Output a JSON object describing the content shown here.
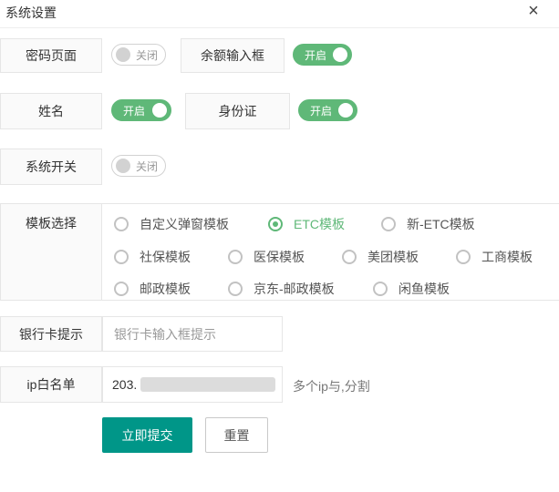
{
  "dialog": {
    "title": "系统设置",
    "close": "×"
  },
  "rows": {
    "password_page": {
      "label": "密码页面",
      "toggle": "关闭",
      "state": "off"
    },
    "balance_input": {
      "label": "余额输入框",
      "toggle": "开启",
      "state": "on"
    },
    "name": {
      "label": "姓名",
      "toggle": "开启",
      "state": "on"
    },
    "id_card": {
      "label": "身份证",
      "toggle": "开启",
      "state": "on"
    },
    "system_switch": {
      "label": "系统开关",
      "toggle": "关闭",
      "state": "off"
    }
  },
  "template": {
    "label": "模板选择",
    "options": [
      "自定义弹窗模板",
      "ETC模板",
      "新-ETC模板",
      "社保模板",
      "医保模板",
      "美团模板",
      "工商模板",
      "邮政模板",
      "京东-邮政模板",
      "闲鱼模板"
    ],
    "selected": "ETC模板"
  },
  "bank_card": {
    "label": "银行卡提示",
    "placeholder": "银行卡输入框提示"
  },
  "ip_whitelist": {
    "label": "ip白名单",
    "value": "203.",
    "hint": "多个ip与,分割"
  },
  "actions": {
    "submit": "立即提交",
    "reset": "重置"
  },
  "colors": {
    "accent": "#5fb878",
    "primary": "#009688"
  }
}
